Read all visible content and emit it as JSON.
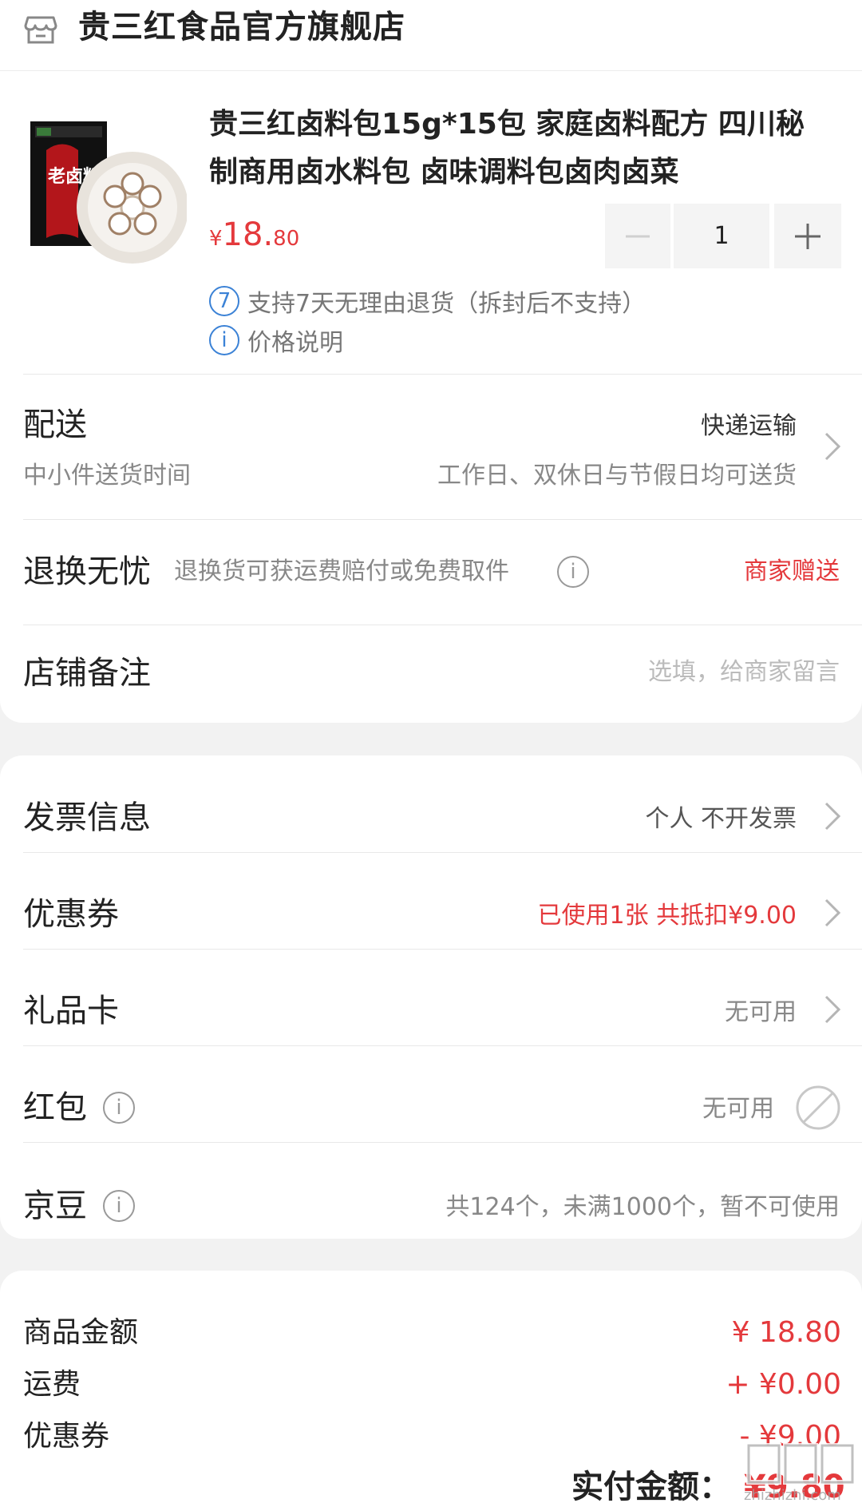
{
  "store": {
    "name": "贵三红食品官方旗舰店",
    "icon": "store-icon"
  },
  "product": {
    "title": "贵三红卤料包15g*15包 家庭卤料配方 四川秘制商用卤水料包 卤味调料包卤肉卤菜",
    "price_currency": "¥",
    "price_integer": "18.",
    "price_decimal": "80",
    "quantity": "1",
    "return_badge": "7",
    "return_policy": "支持7天无理由退货（拆封后不支持）",
    "price_note": "价格说明",
    "thumb_text": "老卤料"
  },
  "delivery": {
    "title": "配送",
    "method": "快递运输",
    "sub_left": "中小件送货时间",
    "sub_right": "工作日、双休日与节假日均可送货"
  },
  "returns": {
    "title": "退换无忧",
    "desc": "退换货可获运费赔付或免费取件",
    "right": "商家赠送"
  },
  "remark": {
    "title": "店铺备注",
    "placeholder": "选填，给商家留言"
  },
  "invoice": {
    "title": "发票信息",
    "value": "个人 不开发票"
  },
  "coupon": {
    "title": "优惠券",
    "value": "已使用1张 共抵扣¥9.00"
  },
  "giftcard": {
    "title": "礼品卡",
    "value": "无可用"
  },
  "redpacket": {
    "title": "红包",
    "value": "无可用"
  },
  "jingdou": {
    "title": "京豆",
    "value": "共124个，未满1000个，暂不可使用"
  },
  "summary": {
    "goods_label": "商品金额",
    "goods_value": "¥ 18.80",
    "shipping_label": "运费",
    "shipping_value": "+ ¥0.00",
    "coupon_label": "优惠券",
    "coupon_value": "- ¥9.00",
    "total_label": "实付金额：",
    "total_value": "¥9.80"
  },
  "watermark": {
    "text": "zhizhizhi.com"
  },
  "colors": {
    "accent_red": "#e4393c",
    "info_blue": "#3b82d6",
    "muted_gray": "#888888"
  }
}
